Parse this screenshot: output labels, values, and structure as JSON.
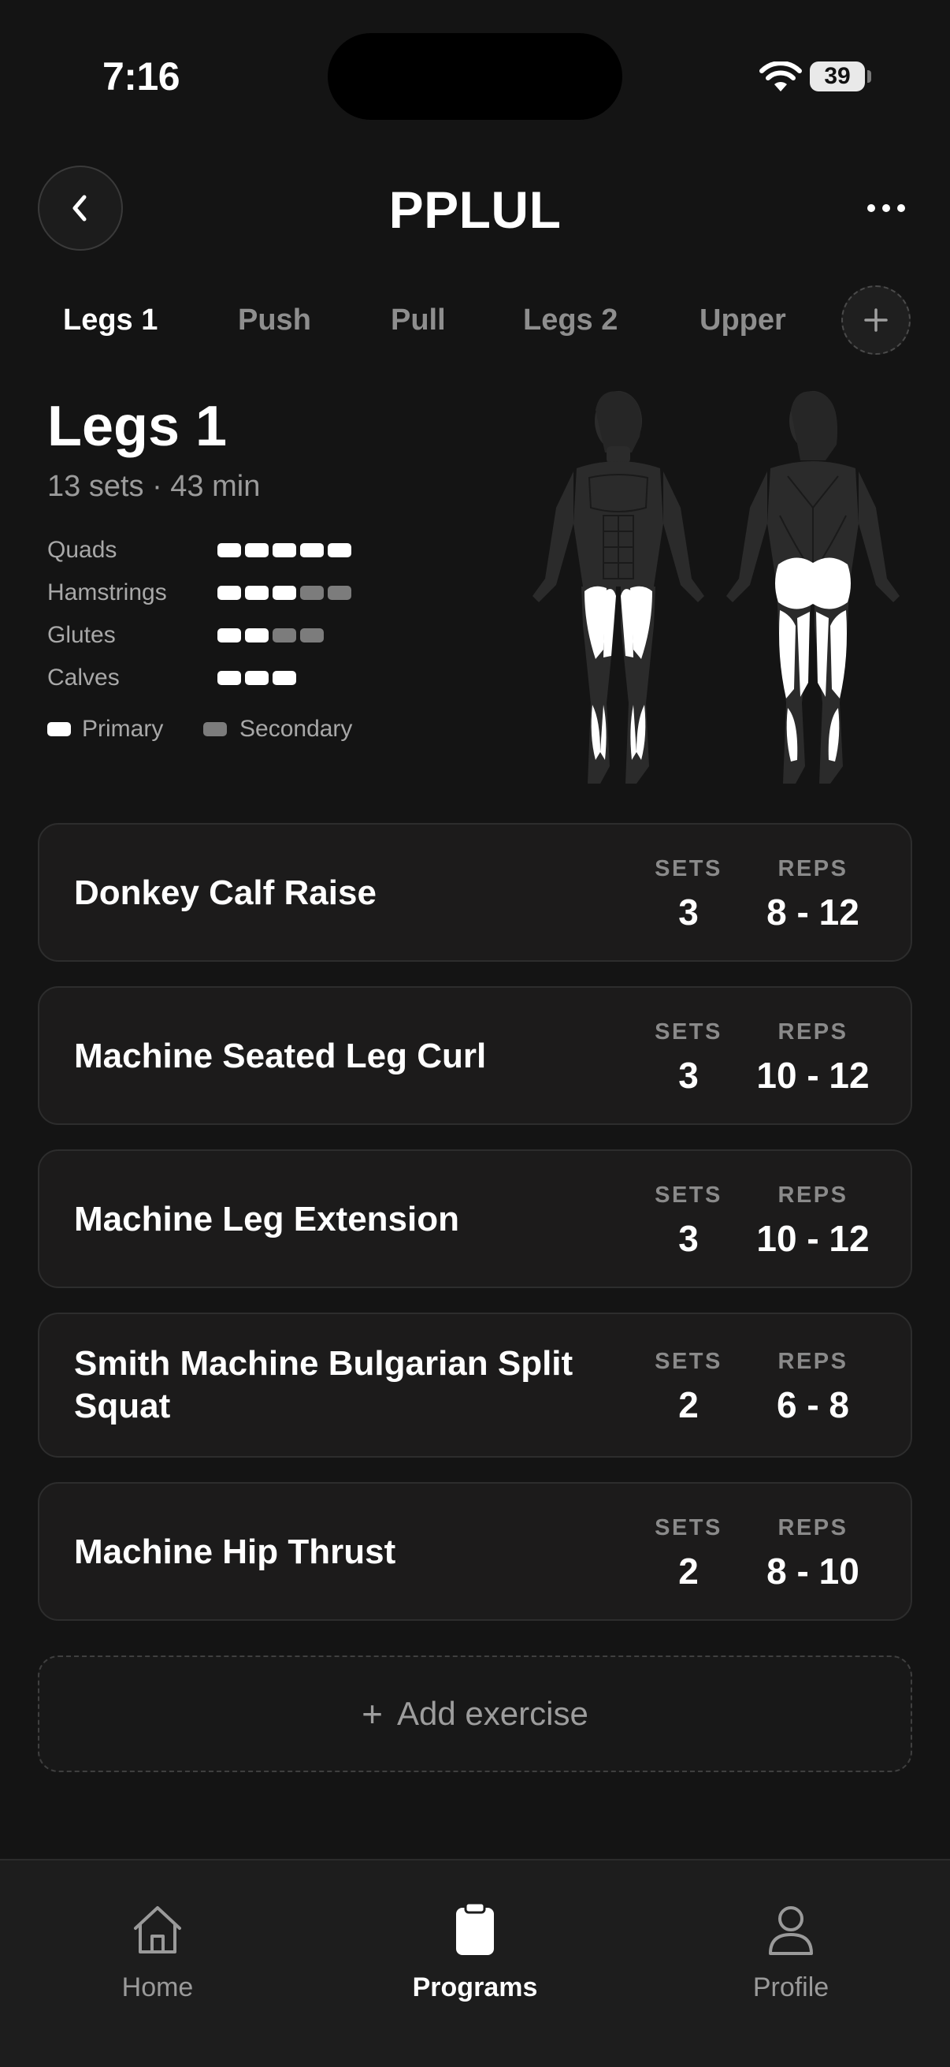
{
  "status_bar": {
    "time": "7:16",
    "battery": "39"
  },
  "header": {
    "title": "PPLUL"
  },
  "tabs": [
    {
      "label": "Legs 1",
      "active": true
    },
    {
      "label": "Push",
      "active": false
    },
    {
      "label": "Pull",
      "active": false
    },
    {
      "label": "Legs 2",
      "active": false
    },
    {
      "label": "Upper",
      "active": false
    }
  ],
  "workout": {
    "title": "Legs 1",
    "meta": "13 sets · 43 min",
    "muscles": [
      {
        "name": "Quads",
        "primary": 5,
        "secondary": 0
      },
      {
        "name": "Hamstrings",
        "primary": 3,
        "secondary": 2
      },
      {
        "name": "Glutes",
        "primary": 2,
        "secondary": 2
      },
      {
        "name": "Calves",
        "primary": 3,
        "secondary": 0
      }
    ],
    "legend": {
      "primary": "Primary",
      "secondary": "Secondary"
    }
  },
  "columns": {
    "sets": "SETS",
    "reps": "REPS"
  },
  "exercises": [
    {
      "name": "Donkey Calf Raise",
      "sets": "3",
      "reps": "8 - 12"
    },
    {
      "name": "Machine Seated Leg Curl",
      "sets": "3",
      "reps": "10 - 12"
    },
    {
      "name": "Machine Leg Extension",
      "sets": "3",
      "reps": "10 - 12"
    },
    {
      "name": "Smith Machine Bulgarian Split Squat",
      "sets": "2",
      "reps": "6 - 8"
    },
    {
      "name": "Machine Hip Thrust",
      "sets": "2",
      "reps": "8 - 10"
    }
  ],
  "add_exercise": {
    "plus": "+",
    "label": "Add exercise"
  },
  "bottom_nav": [
    {
      "label": "Home",
      "icon": "home-icon",
      "active": false
    },
    {
      "label": "Programs",
      "icon": "clipboard-icon",
      "active": true
    },
    {
      "label": "Profile",
      "icon": "person-icon",
      "active": false
    }
  ],
  "colors": {
    "background": "#141414",
    "card": "#1c1b1b",
    "primary_pill": "#ffffff",
    "secondary_pill": "#7c7c7c",
    "muted_text": "#8e8e8e"
  }
}
